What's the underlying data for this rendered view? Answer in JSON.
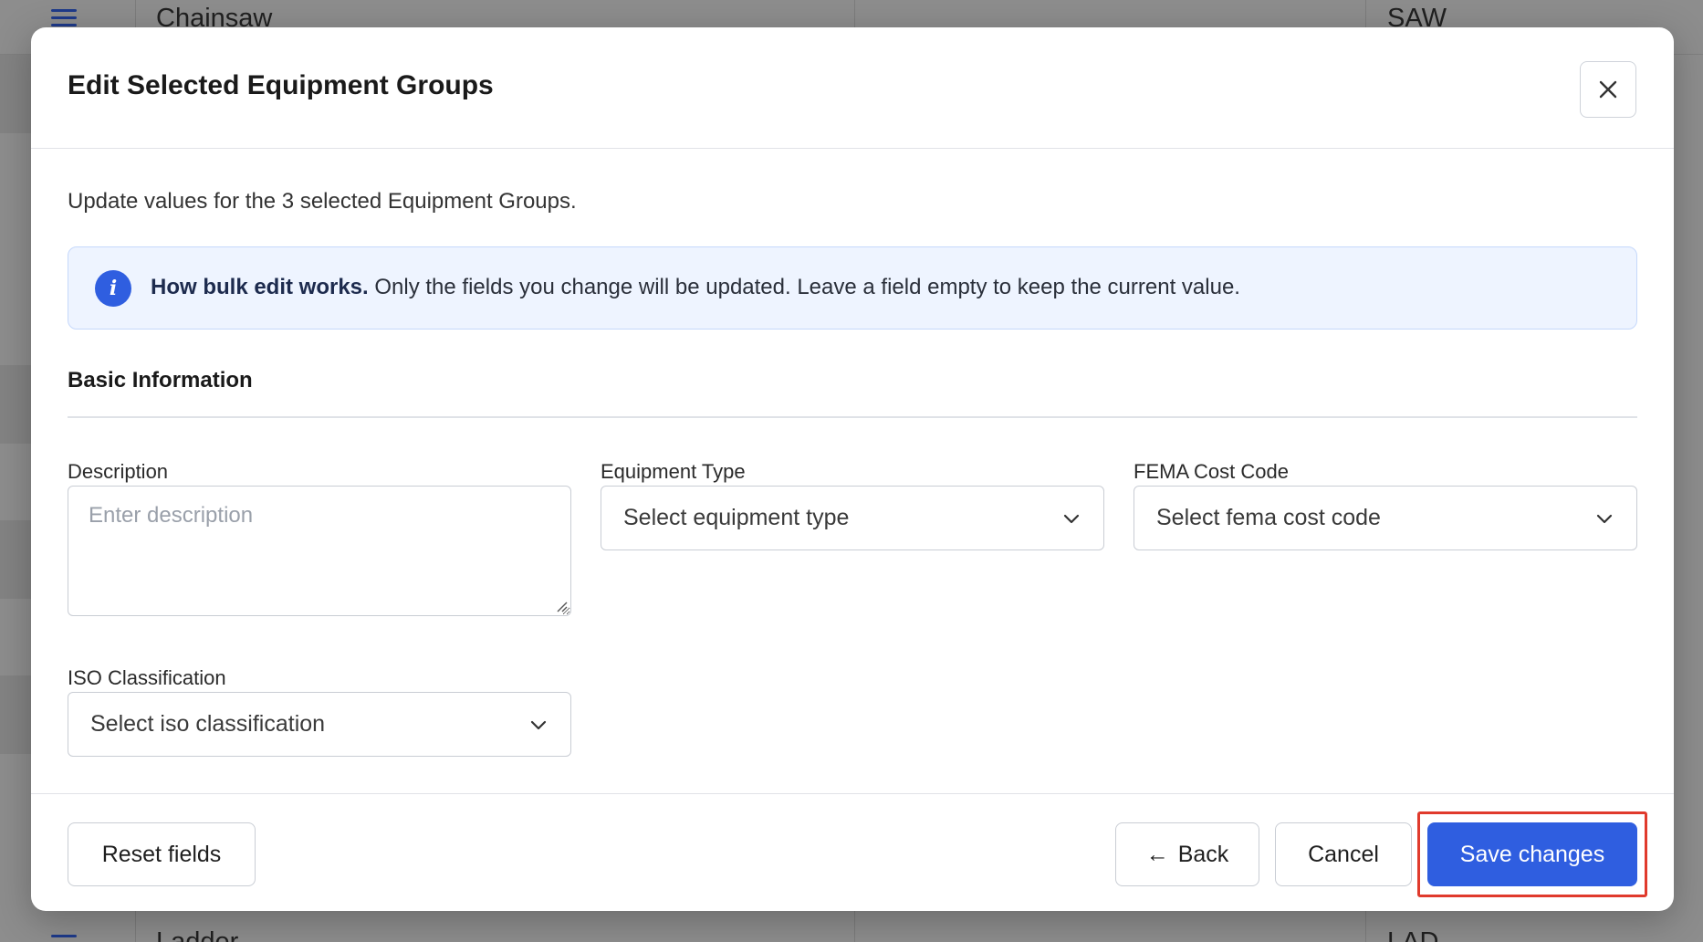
{
  "background": {
    "top_row": {
      "name": "Chainsaw",
      "code": "SAW"
    },
    "bottom_row": {
      "name": "Ladder",
      "code": "LAD"
    }
  },
  "modal": {
    "title": "Edit Selected Equipment Groups",
    "intro": "Update values for the 3 selected Equipment Groups.",
    "info": {
      "bold": "How bulk edit works.",
      "text": " Only the fields you change will be updated. Leave a field empty to keep the current value.",
      "icon": "i"
    },
    "section_title": "Basic Information",
    "fields": {
      "description": {
        "label": "Description",
        "placeholder": "Enter description"
      },
      "equipment_type": {
        "label": "Equipment Type",
        "value": "Select equipment type"
      },
      "fema_cost_code": {
        "label": "FEMA Cost Code",
        "value": "Select fema cost code"
      },
      "iso_classification": {
        "label": "ISO Classification",
        "value": "Select iso classification"
      }
    },
    "footer": {
      "reset_label": "Reset fields",
      "back_label": "Back",
      "back_arrow": "←",
      "cancel_label": "Cancel",
      "save_label": "Save changes"
    }
  },
  "colors": {
    "primary": "#2f5ee0",
    "info_bg": "#eef4ff",
    "highlight": "#e03a2c"
  }
}
